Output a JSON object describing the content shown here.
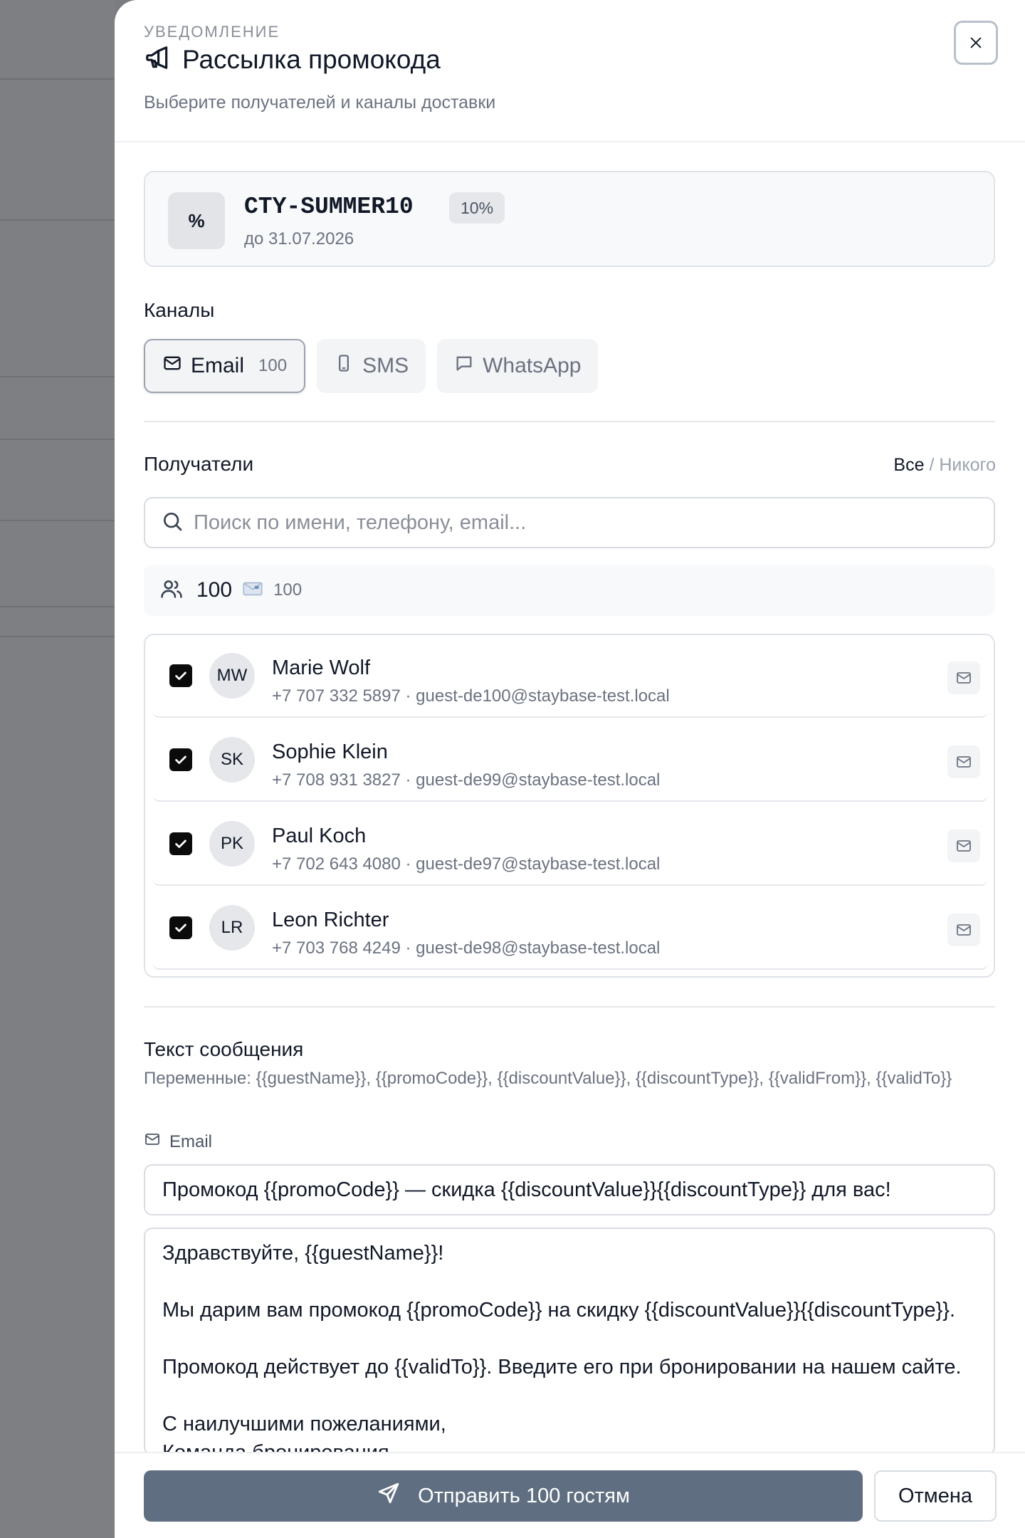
{
  "header": {
    "eyebrow": "УВЕДОМЛЕНИЕ",
    "title": "Рассылка промокода",
    "subtitle": "Выберите получателей и каналы доставки"
  },
  "promo": {
    "icon_symbol": "%",
    "code": "CTY-SUMMER10",
    "badge": "10%",
    "valid_until": "до 31.07.2026"
  },
  "channels": {
    "label": "Каналы",
    "items": [
      {
        "label": "Email",
        "count": "100",
        "icon": "mail-icon",
        "active": true
      },
      {
        "label": "SMS",
        "icon": "phone-icon",
        "active": false
      },
      {
        "label": "WhatsApp",
        "icon": "chat-icon",
        "active": false
      }
    ]
  },
  "recipients": {
    "label": "Получатели",
    "select_all": "Все",
    "separator": "/",
    "select_none": "Никого",
    "search_placeholder": "Поиск по имени, телефону, email...",
    "total": "100",
    "email_count": "100",
    "guests": [
      {
        "initials": "MW",
        "name": "Marie Wolf",
        "meta": "+7 707 332 5897 · guest-de100@staybase-test.local",
        "checked": true
      },
      {
        "initials": "SK",
        "name": "Sophie Klein",
        "meta": "+7 708 931 3827 · guest-de99@staybase-test.local",
        "checked": true
      },
      {
        "initials": "PK",
        "name": "Paul Koch",
        "meta": "+7 702 643 4080 · guest-de97@staybase-test.local",
        "checked": true
      },
      {
        "initials": "LR",
        "name": "Leon Richter",
        "meta": "+7 703 768 4249 · guest-de98@staybase-test.local",
        "checked": true
      }
    ]
  },
  "message": {
    "label": "Текст сообщения",
    "variables": "Переменные: {{guestName}}, {{promoCode}}, {{discountValue}}, {{discountType}}, {{validFrom}}, {{validTo}}",
    "channel_label": "Email",
    "subject": "Промокод {{promoCode}} — скидка {{discountValue}}{{discountType}} для вас!",
    "body_lines": [
      "Здравствуйте, {{guestName}}!",
      "",
      "Мы дарим вам промокод {{promoCode}} на скидку {{discountValue}}{{discountType}}.",
      "",
      "Промокод действует до {{validTo}}. Введите его при бронировании на нашем сайте.",
      "",
      "С наилучшими пожеланиями,",
      "Команда бронирования"
    ]
  },
  "footer": {
    "send_label": "Отправить 100 гостям",
    "cancel_label": "Отмена"
  },
  "colors": {
    "primary_button": "#5f6f81",
    "backdrop": "#7a7c80",
    "checkbox": "#0b0b0b"
  }
}
